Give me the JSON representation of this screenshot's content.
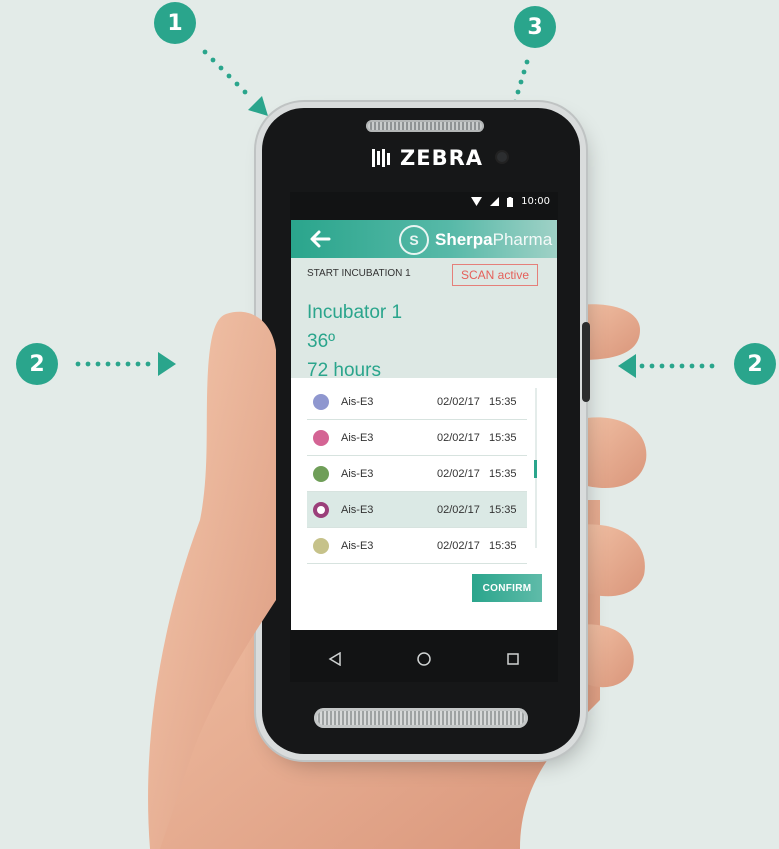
{
  "callouts": [
    {
      "number": "1"
    },
    {
      "number": "2"
    },
    {
      "number": "3"
    },
    {
      "number": "2"
    }
  ],
  "device": {
    "brand": "ZEBRA",
    "status": {
      "time": "10:00",
      "icons": [
        "wifi-icon",
        "signal-icon",
        "battery-icon"
      ]
    }
  },
  "app": {
    "logo_bold": "Sherpa",
    "logo_light": "Pharma",
    "task_title": "START INCUBATION 1",
    "scan_label": "SCAN active",
    "incubator_name": "Incubator 1",
    "temperature": "36º",
    "duration": "72 hours",
    "samples": [
      {
        "name": "Ais-E3",
        "date": "02/02/17",
        "time": "15:35",
        "color": "#8f97cf",
        "selected": false
      },
      {
        "name": "Ais-E3",
        "date": "02/02/17",
        "time": "15:35",
        "color": "#d46494",
        "selected": false
      },
      {
        "name": "Ais-E3",
        "date": "02/02/17",
        "time": "15:35",
        "color": "#6f9e58",
        "selected": false
      },
      {
        "name": "Ais-E3",
        "date": "02/02/17",
        "time": "15:35",
        "color": "#9b3f7a",
        "selected": true
      },
      {
        "name": "Ais-E3",
        "date": "02/02/17",
        "time": "15:35",
        "color": "#c6c28a",
        "selected": false
      }
    ],
    "confirm_label": "CONFIRM",
    "colors": {
      "accent": "#2aa58c",
      "scan": "#e5605a",
      "header_bg": "#dde8e4"
    }
  },
  "nav": [
    "back-nav-icon",
    "home-nav-icon",
    "recents-nav-icon"
  ]
}
